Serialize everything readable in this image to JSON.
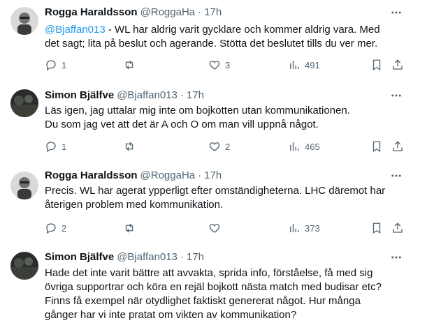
{
  "tweets": [
    {
      "name": "Rogga Haraldsson",
      "handle": "@RoggaHa",
      "time": "17h",
      "mention": "@Bjaffan013",
      "lines": [
        " - WL har aldrig varit gycklare och kommer aldrig vara. Med",
        "det sagt; lita på beslut och agerande. Stötta det beslutet tills du ver mer."
      ],
      "replies": "1",
      "retweets": "",
      "likes": "3",
      "views": "491",
      "avatar": "photo-grayscale"
    },
    {
      "name": "Simon Bjälfve",
      "handle": "@Bjaffan013",
      "time": "17h",
      "lines": [
        "Läs igen, jag uttalar mig inte om bojkotten utan kommunikationen.",
        "Du som jag vet att det är A och O om man vill uppnå något."
      ],
      "replies": "1",
      "retweets": "",
      "likes": "2",
      "views": "465",
      "avatar": "photo-dark"
    },
    {
      "name": "Rogga Haraldsson",
      "handle": "@RoggaHa",
      "time": "17h",
      "lines": [
        "Precis. WL har agerat ypperligt efter omständigheterna. LHC däremot har",
        "återigen problem med kommunikation."
      ],
      "replies": "2",
      "retweets": "",
      "likes": "",
      "views": "373",
      "avatar": "photo-grayscale"
    },
    {
      "name": "Simon Bjälfve",
      "handle": "@Bjaffan013",
      "time": "17h",
      "lines": [
        "Hade det inte varit bättre att avvakta, sprida info, förståelse, få med sig",
        "övriga supportrar och köra en rejäl bojkott nästa match med budisar etc?",
        "Finns få exempel när otydlighet faktiskt genererat något. Hur många",
        "gånger har vi inte pratat om vikten av kommunikation?"
      ],
      "avatar": "photo-dark"
    }
  ],
  "separator": "·"
}
